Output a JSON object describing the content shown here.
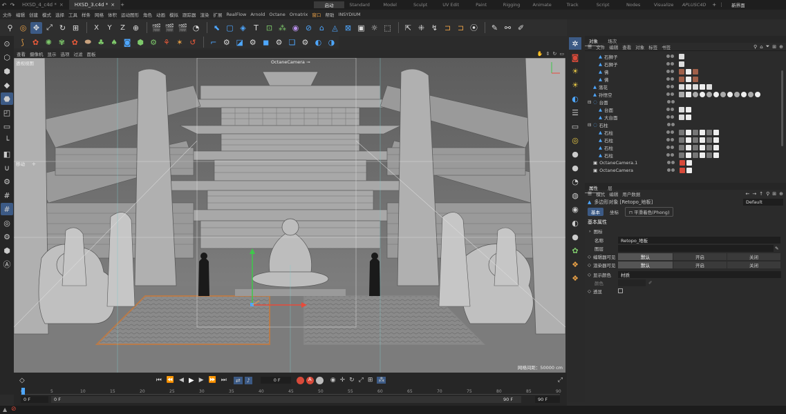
{
  "titlebar": {
    "tabs": [
      {
        "label": "HXSD_4_c4d *",
        "active": false
      },
      {
        "label": "HXSD_3.c4d *",
        "active": true
      }
    ],
    "layouts": [
      "启动",
      "Standard",
      "Model",
      "Sculpt",
      "UV Edit",
      "Paint",
      "Rigging",
      "Animate",
      "Track",
      "Script",
      "Nodes",
      "Visualize",
      "APLUSC4D"
    ],
    "selected_layout": "启动",
    "new_layout_label": "新界面"
  },
  "menubar": {
    "items": [
      "文件",
      "编辑",
      "创建",
      "模式",
      "选择",
      "工具",
      "样条",
      "网格",
      "体积",
      "运动图形",
      "角色",
      "动画",
      "模拟",
      "跟踪器",
      "渲染",
      "扩展",
      "RealFlow",
      "Arnold",
      "Octane",
      "Ornatrix",
      "窗口",
      "帮助",
      "INSYDIUM"
    ],
    "highlighted": [
      "窗口"
    ]
  },
  "toolbar": {
    "axis_x": "X",
    "axis_y": "Y",
    "axis_z": "Z"
  },
  "viewport": {
    "menu": [
      "查看",
      "摄像机",
      "显示",
      "选项",
      "过滤",
      "面板"
    ],
    "view_label": "透视视图",
    "camera_label": "OctaneCamera",
    "move_label": "移动",
    "grid_info": "网格间距：50000 cm"
  },
  "timeline": {
    "current_frame": "0 F",
    "start_field": "0 F",
    "start_field2": "0 F",
    "end_field": "90 F",
    "end_field2": "90 F",
    "ticks": [
      "0",
      "5",
      "10",
      "15",
      "20",
      "25",
      "30",
      "35",
      "40",
      "45",
      "50",
      "55",
      "60",
      "65",
      "70",
      "75",
      "80",
      "85",
      "90"
    ]
  },
  "objects_panel": {
    "tabs": [
      "对象",
      "场次"
    ],
    "menu": [
      "文件",
      "编辑",
      "查看",
      "对象",
      "标签",
      "书签"
    ],
    "items": [
      {
        "name": "石狮子",
        "indent": 1
      },
      {
        "name": "石狮子",
        "indent": 1
      },
      {
        "name": "佛",
        "indent": 1
      },
      {
        "name": "佛",
        "indent": 1
      },
      {
        "name": "落花",
        "indent": 0
      },
      {
        "name": "孙悟空",
        "indent": 0
      },
      {
        "name": "台面",
        "indent": 0,
        "group": true
      },
      {
        "name": "台面",
        "indent": 1
      },
      {
        "name": "大台面",
        "indent": 1
      },
      {
        "name": "石柱",
        "indent": 0,
        "group": true
      },
      {
        "name": "石柱",
        "indent": 1
      },
      {
        "name": "石柱",
        "indent": 1
      },
      {
        "name": "石柱",
        "indent": 1
      },
      {
        "name": "石柱",
        "indent": 1
      },
      {
        "name": "OctaneCamera.1",
        "indent": 0
      },
      {
        "name": "OctaneCamera",
        "indent": 0
      }
    ]
  },
  "attributes_panel": {
    "tabs": [
      "属性",
      "层"
    ],
    "menu": [
      "模式",
      "编辑",
      "用户数据"
    ],
    "object_title": "多边形对象 [Retopo_地板]",
    "preset": "Default",
    "subtabs": [
      "基本",
      "坐标",
      "平滑着色(Phong)"
    ],
    "section": "基本属性",
    "icon_label": "图标",
    "name_label": "名称",
    "name_value": "Retopo_地板",
    "layer_label": "图层",
    "editor_visible_label": "编辑器可见",
    "render_visible_label": "渲染器可见",
    "options": [
      "默认",
      "开启",
      "关闭"
    ],
    "display_color_label": "显示颜色",
    "display_color_value": "材质",
    "color_label": "颜色",
    "xray_label": "透显"
  },
  "colors": {
    "accent_blue": "#3c5a85",
    "highlight_orange": "#e8a046",
    "timeline_red": "#d84a3a"
  }
}
